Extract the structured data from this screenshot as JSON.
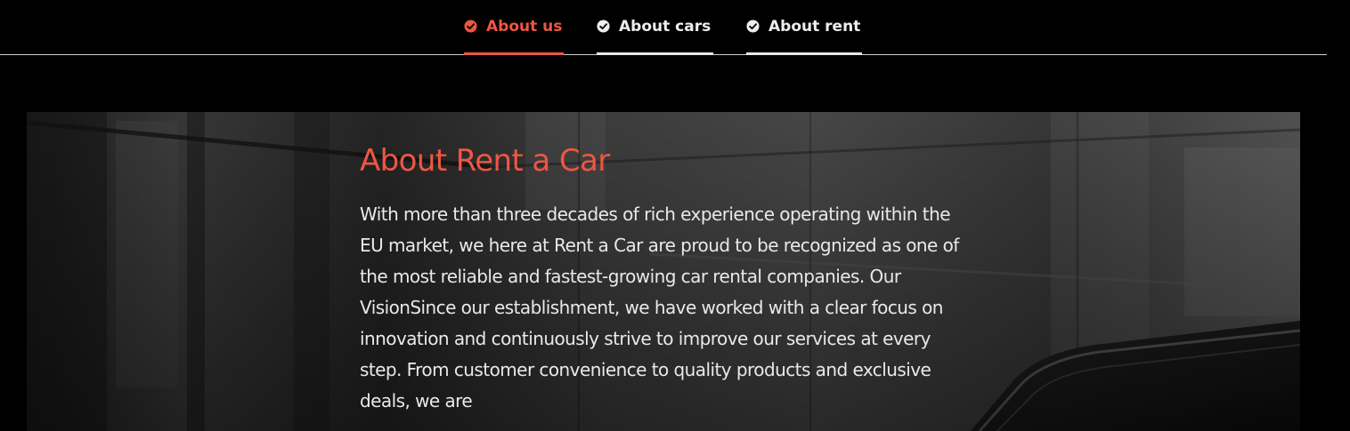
{
  "tabs": [
    {
      "label": "About us",
      "active": true,
      "icon": "check-circle-icon"
    },
    {
      "label": "About cars",
      "active": false,
      "icon": "check-circle-icon"
    },
    {
      "label": "About rent",
      "active": false,
      "icon": "check-circle-icon"
    }
  ],
  "about": {
    "title": "About Rent a Car",
    "body": "With more than three decades of rich experience operating within the EU market, we here at Rent a Car are proud to be recognized as one of the most reliable and fastest-growing car rental companies. Our VisionSince our establishment, we have worked with a clear focus on innovation and continuously strive to improve our services at every step. From customer convenience to quality products and exclusive deals, we are"
  },
  "colors": {
    "accent": "#ef5644",
    "tab_text": "#ededf2",
    "background": "#000000",
    "divider": "#cfcfd6"
  }
}
